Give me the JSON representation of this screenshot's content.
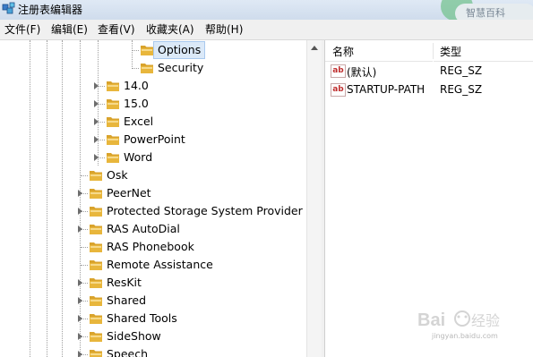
{
  "window": {
    "title": "注册表编辑器",
    "brand_color": "#5aa0d8"
  },
  "menu": [
    {
      "label": "文件(F)"
    },
    {
      "label": "编辑(E)"
    },
    {
      "label": "查看(V)"
    },
    {
      "label": "收藏夹(A)"
    },
    {
      "label": "帮助(H)"
    }
  ],
  "tree": {
    "selected_color": "#dbe9f8",
    "folder_color": "#e8b63c",
    "items": [
      {
        "label": "Options",
        "level": 4,
        "expandable": false,
        "selected": true,
        "icon": "folder-icon"
      },
      {
        "label": "Security",
        "level": 4,
        "expandable": false,
        "selected": false,
        "icon": "folder-icon"
      },
      {
        "label": "14.0",
        "level": 3,
        "expandable": true,
        "selected": false,
        "icon": "folder-icon"
      },
      {
        "label": "15.0",
        "level": 3,
        "expandable": true,
        "selected": false,
        "icon": "folder-icon"
      },
      {
        "label": "Excel",
        "level": 3,
        "expandable": true,
        "selected": false,
        "icon": "folder-icon"
      },
      {
        "label": "PowerPoint",
        "level": 3,
        "expandable": true,
        "selected": false,
        "icon": "folder-icon"
      },
      {
        "label": "Word",
        "level": 3,
        "expandable": true,
        "selected": false,
        "icon": "folder-icon"
      },
      {
        "label": "Osk",
        "level": 2,
        "expandable": false,
        "selected": false,
        "icon": "folder-icon"
      },
      {
        "label": "PeerNet",
        "level": 2,
        "expandable": true,
        "selected": false,
        "icon": "folder-icon"
      },
      {
        "label": "Protected Storage System Provider",
        "level": 2,
        "expandable": true,
        "selected": false,
        "icon": "folder-icon"
      },
      {
        "label": "RAS AutoDial",
        "level": 2,
        "expandable": true,
        "selected": false,
        "icon": "folder-icon"
      },
      {
        "label": "RAS Phonebook",
        "level": 2,
        "expandable": false,
        "selected": false,
        "icon": "folder-icon"
      },
      {
        "label": "Remote Assistance",
        "level": 2,
        "expandable": false,
        "selected": false,
        "icon": "folder-icon"
      },
      {
        "label": "ResKit",
        "level": 2,
        "expandable": true,
        "selected": false,
        "icon": "folder-icon"
      },
      {
        "label": "Shared",
        "level": 2,
        "expandable": true,
        "selected": false,
        "icon": "folder-icon"
      },
      {
        "label": "Shared Tools",
        "level": 2,
        "expandable": true,
        "selected": false,
        "icon": "folder-icon"
      },
      {
        "label": "SideShow",
        "level": 2,
        "expandable": true,
        "selected": false,
        "icon": "folder-icon"
      },
      {
        "label": "Speech",
        "level": 2,
        "expandable": true,
        "selected": false,
        "icon": "folder-icon"
      }
    ]
  },
  "values": {
    "columns": [
      {
        "label": "名称"
      },
      {
        "label": "类型"
      }
    ],
    "rows": [
      {
        "name": "(默认)",
        "type": "REG_SZ",
        "icon": "string-value-icon"
      },
      {
        "name": "STARTUP-PATH",
        "type": "REG_SZ",
        "icon": "string-value-icon"
      }
    ]
  },
  "overlay": {
    "title_pill_text": "智慧百科",
    "watermark_url": "jingyan.baidu.com"
  }
}
